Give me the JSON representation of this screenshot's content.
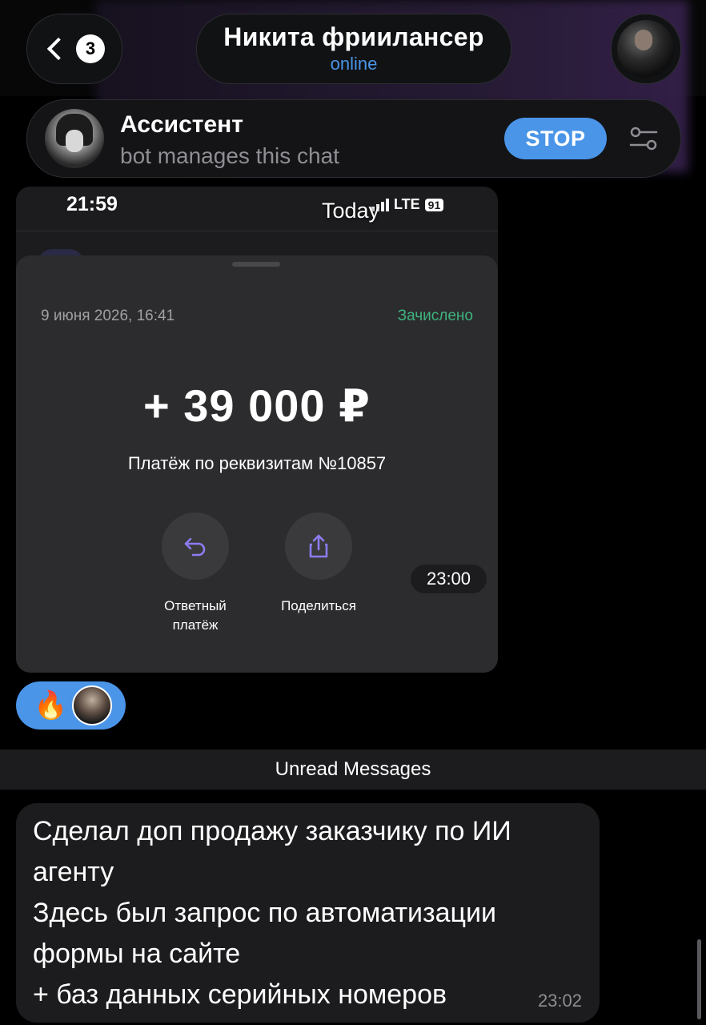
{
  "header": {
    "back_badge": "3",
    "title": "Никита фриилансер",
    "status": "online"
  },
  "assistant": {
    "name": "Ассистент",
    "subtitle": "bot manages this chat",
    "stop_label": "STOP"
  },
  "screenshot": {
    "time": "21:59",
    "network": "LTE",
    "battery": "91",
    "overlay_date": "Today",
    "payment": {
      "date": "9 июня 2026, 16:41",
      "status": "Зачислено",
      "amount": "+ 39 000 ₽",
      "description": "Платёж по реквизитам №10857",
      "action_reply_line1": "Ответный",
      "action_reply_line2": "платёж",
      "action_share": "Поделиться"
    },
    "message_time": "23:00"
  },
  "reaction": {
    "emoji": "🔥"
  },
  "divider": {
    "label": "Unread Messages"
  },
  "message": {
    "lines": [
      "Сделал доп продажу заказчику по ИИ",
      "агенту",
      "Здесь был запрос по автоматизации",
      "формы на сайте",
      "+ баз данных серийных номеров"
    ],
    "time": "23:02"
  },
  "colors": {
    "accent": "#4a95e8",
    "credited": "#3fb37f",
    "bubble": "#1c1c1e"
  }
}
